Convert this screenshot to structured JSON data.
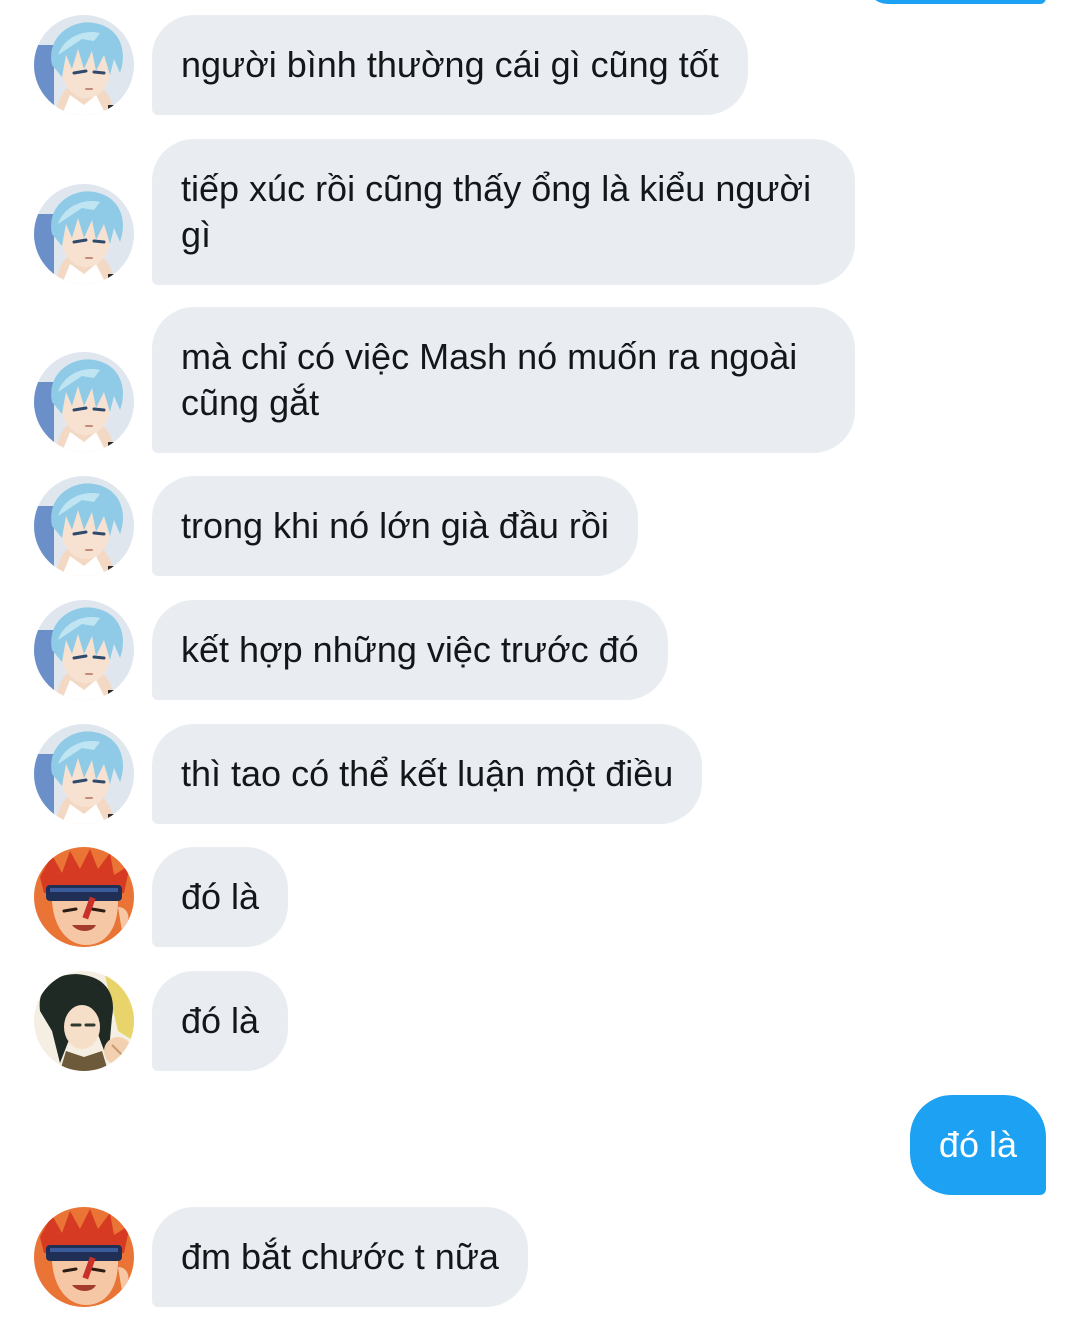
{
  "colors": {
    "received_bubble": "#e9edf1",
    "sent_bubble": "#1da1f2",
    "received_text": "#14171a",
    "sent_text": "#ffffff"
  },
  "messages": [
    {
      "sender": "blue-hair-user",
      "direction": "received",
      "text": "người bình thường cái gì cũng tốt"
    },
    {
      "sender": "blue-hair-user",
      "direction": "received",
      "text": "tiếp xúc rồi cũng thấy ổng là kiểu người gì"
    },
    {
      "sender": "blue-hair-user",
      "direction": "received",
      "text": "mà chỉ có việc Mash nó muốn ra ngoài cũng gắt"
    },
    {
      "sender": "blue-hair-user",
      "direction": "received",
      "text": "trong khi nó lớn già đầu rồi"
    },
    {
      "sender": "blue-hair-user",
      "direction": "received",
      "text": "kết hợp những việc trước đó"
    },
    {
      "sender": "blue-hair-user",
      "direction": "received",
      "text": "thì tao có thể kết luận một điều"
    },
    {
      "sender": "red-hair-user",
      "direction": "received",
      "text": "đó là"
    },
    {
      "sender": "dark-hair-user",
      "direction": "received",
      "text": "đó là"
    },
    {
      "sender": "me",
      "direction": "sent",
      "text": "đó là"
    },
    {
      "sender": "red-hair-user",
      "direction": "received",
      "text": "đm bắt chước t nữa"
    }
  ]
}
